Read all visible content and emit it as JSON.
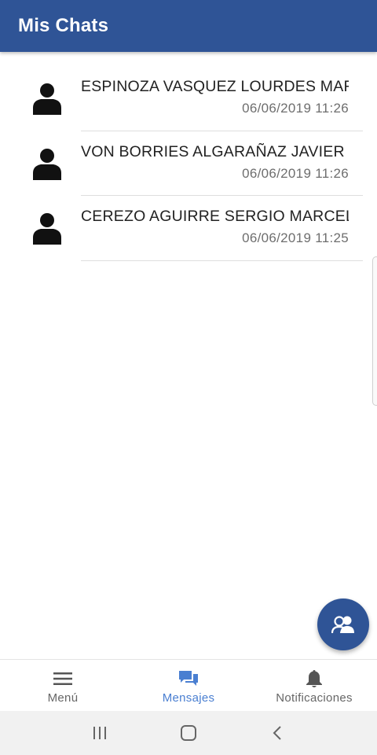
{
  "header": {
    "title": "Mis Chats"
  },
  "chats": [
    {
      "name": "ESPINOZA VASQUEZ LOURDES MARCELA",
      "time": "06/06/2019 11:26"
    },
    {
      "name": "VON BORRIES ALGARAÑAZ JAVIER TADEO",
      "time": "06/06/2019 11:26"
    },
    {
      "name": "CEREZO AGUIRRE SERGIO MARCELO",
      "time": "06/06/2019 11:25"
    }
  ],
  "bottom_nav": {
    "items": [
      {
        "label": "Menú",
        "icon": "menu-icon",
        "active": false
      },
      {
        "label": "Mensajes",
        "icon": "chat-bubbles-icon",
        "active": true
      },
      {
        "label": "Notificaciones",
        "icon": "bell-icon",
        "active": false
      }
    ]
  },
  "fab": {
    "icon": "new-chat-users-icon"
  },
  "colors": {
    "primary": "#2f5496",
    "active_nav": "#4a7fd1",
    "nav_inactive": "#666666"
  }
}
